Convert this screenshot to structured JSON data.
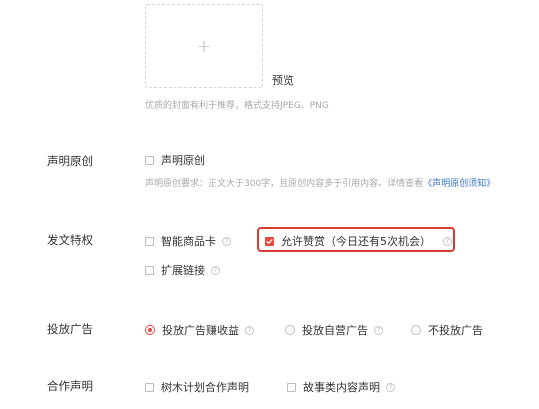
{
  "cover": {
    "plus_glyph": "+",
    "preview_label": "预览",
    "hint": "优质的封面有利于推荐，格式支持JPEG、PNG"
  },
  "original": {
    "label": "声明原创",
    "checkbox_label": "声明原创",
    "hint_prefix": "声明原创要求：正文大于300字，且原创内容多于引用内容。详情查看",
    "hint_link": "《声明原创须知》"
  },
  "features": {
    "label": "发文特权",
    "smart_card": "智能商品卡",
    "allow_reward": "允许赞赏（今日还有5次机会）",
    "extend_link": "扩展链接"
  },
  "ads": {
    "label": "投放广告",
    "options": [
      "投放广告赚收益",
      "投放自营广告",
      "不投放广告"
    ],
    "selected_index": 0
  },
  "cooperation": {
    "label": "合作声明",
    "options": [
      "树木计划合作声明",
      "故事类内容声明"
    ]
  },
  "colors": {
    "accent": "#e5483c",
    "highlight_border": "#d93a34",
    "link": "#3a73c9"
  }
}
